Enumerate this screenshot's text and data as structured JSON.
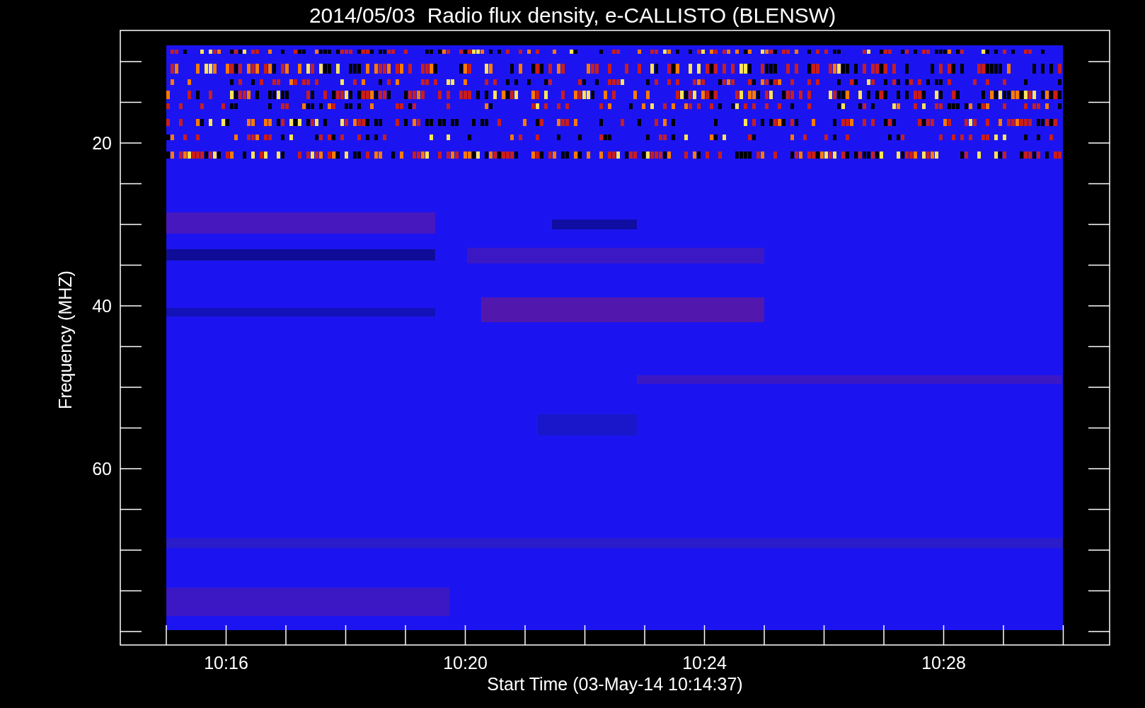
{
  "title": "2014/05/03  Radio flux density, e-CALLISTO (BLENSW)",
  "y_axis": {
    "label": "Frequency (MHZ)",
    "ticks": [
      "20",
      "40",
      "60"
    ]
  },
  "x_axis": {
    "label": "Start Time (03-May-14 10:14:37)",
    "ticks": [
      "10:16",
      "10:20",
      "10:24",
      "10:28"
    ]
  }
}
